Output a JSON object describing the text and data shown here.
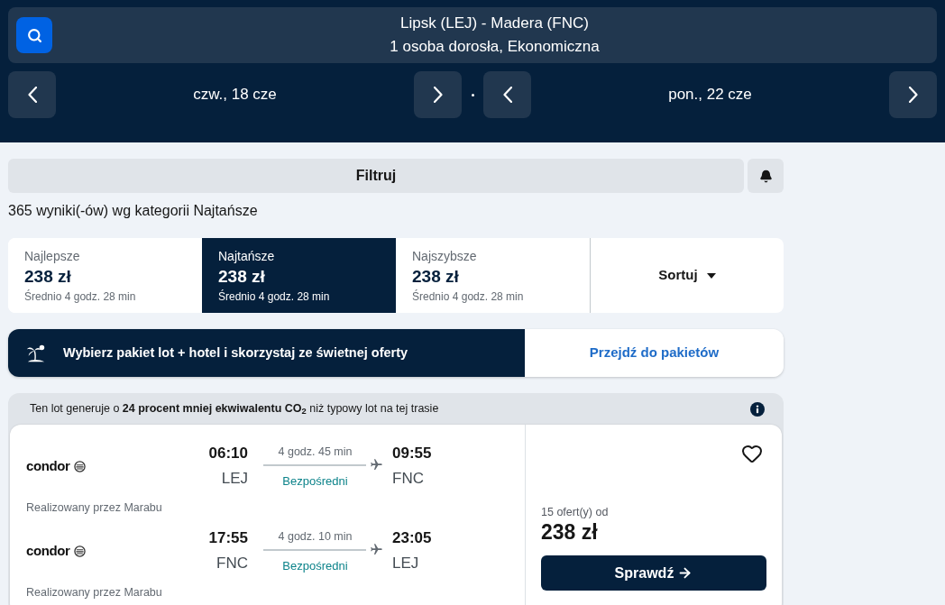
{
  "search": {
    "route": "Lipsk (LEJ) - Madera (FNC)",
    "details": "1 osoba dorosła, Ekonomiczna"
  },
  "dates": [
    {
      "label": "czw., 18 cze"
    },
    {
      "label": "pon., 22 cze"
    }
  ],
  "filter": {
    "label": "Filtruj"
  },
  "results_summary": "365 wyniki(-ów) wg kategorii Najtańsze",
  "sort_tabs": [
    {
      "label": "Najlepsze",
      "price": "238 zł",
      "average": "Średnio 4 godz. 28 min",
      "selected": false
    },
    {
      "label": "Najtańsze",
      "price": "238 zł",
      "average": "Średnio 4 godz. 28 min",
      "selected": true
    },
    {
      "label": "Najszybsze",
      "price": "238 zł",
      "average": "Średnio 4 godz. 28 min",
      "selected": false
    }
  ],
  "sort_menu": {
    "label": "Sortuj"
  },
  "promo": {
    "text": "Wybierz pakiet lot + hotel i skorzystaj ze świetnej oferty",
    "link": "Przejdź do pakietów"
  },
  "flight": {
    "eco_note": "Ten lot generuje o **24 procent mniej ekwiwalentu CO$_{2}$** niż typowy lot na tej trasie",
    "legs": [
      {
        "airline": "condor",
        "depart_time": "06:10",
        "depart_airport": "LEJ",
        "duration": "4 godz. 45 min",
        "stops": "Bezpośredni",
        "arrive_time": "09:55",
        "arrive_airport": "FNC",
        "operated_by": "Realizowany przez Marabu"
      },
      {
        "airline": "condor",
        "depart_time": "17:55",
        "depart_airport": "FNC",
        "duration": "4 godz. 10 min",
        "stops": "Bezpośredni",
        "arrive_time": "23:05",
        "arrive_airport": "LEJ",
        "operated_by": "Realizowany przez Marabu"
      }
    ],
    "saved": false,
    "offers": "15 ofert(y) od",
    "price": "238 zł",
    "button": "Sprawdź"
  }
}
